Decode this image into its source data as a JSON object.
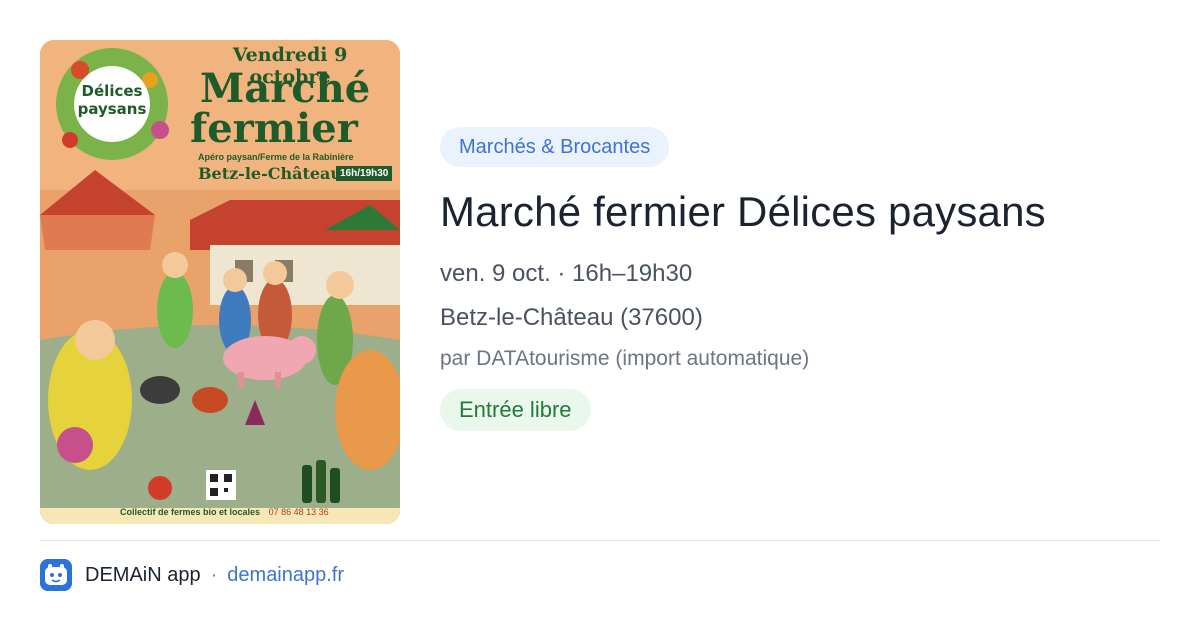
{
  "poster": {
    "date_banner": "Vendredi 9 octobre",
    "headline_line1": "Marché",
    "headline_line2": "fermier",
    "badge_line1": "Délices",
    "badge_line2": "paysans",
    "subtitle": "Apéro paysan/Ferme de la Rabinière",
    "town": "Betz-le-Château",
    "hours": "16h/19h30",
    "collective": "Collectif de fermes bio et locales",
    "phone": "07 86 48 13 36"
  },
  "event": {
    "category": "Marchés & Brocantes",
    "title": "Marché fermier Délices paysans",
    "when": "ven. 9 oct. · 16h–19h30",
    "where": "Betz-le-Château (37600)",
    "source": "par DATAtourisme (import automatique)",
    "price": "Entrée libre"
  },
  "footer": {
    "app_name": "DEMAiN app",
    "separator": "·",
    "domain": "demainapp.fr"
  },
  "colors": {
    "chip_blue_bg": "#eaf2fd",
    "chip_blue_text": "#3f73d1",
    "chip_green_bg": "#e9f7ec",
    "chip_green_text": "#237a3b",
    "poster_green": "#1f5a2a",
    "poster_orange": "#f2b47e"
  },
  "icons": {
    "app_icon": "demain-app-icon"
  }
}
